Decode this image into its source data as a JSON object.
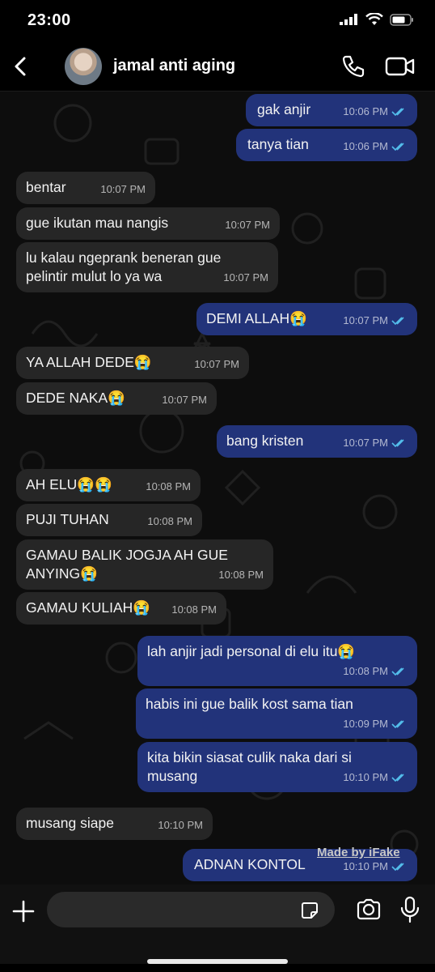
{
  "status_bar": {
    "time": "23:00"
  },
  "header": {
    "contact_name": "jamal anti aging"
  },
  "messages": [
    {
      "dir": "out",
      "text": "gak anjir",
      "time": "10:06 PM"
    },
    {
      "dir": "out",
      "text": "tanya tian",
      "time": "10:06 PM"
    },
    {
      "dir": "in",
      "text": "bentar",
      "time": "10:07 PM"
    },
    {
      "dir": "in",
      "text": "gue ikutan mau nangis",
      "time": "10:07 PM"
    },
    {
      "dir": "in",
      "text": "lu kalau ngeprank beneran gue\npelintir mulut lo ya wa",
      "time": "10:07 PM"
    },
    {
      "dir": "out",
      "text": "DEMI ALLAH😭",
      "time": "10:07 PM"
    },
    {
      "dir": "in",
      "text": "YA ALLAH DEDE😭",
      "time": "10:07 PM"
    },
    {
      "dir": "in",
      "text": "DEDE NAKA😭",
      "time": "10:07 PM"
    },
    {
      "dir": "out",
      "text": "bang kristen",
      "time": "10:07 PM"
    },
    {
      "dir": "in",
      "text": "AH ELU😭😭",
      "time": "10:08 PM"
    },
    {
      "dir": "in",
      "text": "PUJI TUHAN",
      "time": "10:08 PM"
    },
    {
      "dir": "in",
      "text": "GAMAU BALIK JOGJA AH GUE\nANYING😭",
      "time": "10:08 PM"
    },
    {
      "dir": "in",
      "text": "GAMAU KULIAH😭",
      "time": "10:08 PM"
    },
    {
      "dir": "out",
      "text": "lah anjir jadi personal di elu itu😭",
      "time": "10:08 PM"
    },
    {
      "dir": "out",
      "text": "habis ini gue balik kost sama tian",
      "time": "10:09 PM"
    },
    {
      "dir": "out",
      "text": "kita bikin siasat culik naka dari si\nmusang",
      "time": "10:10 PM"
    },
    {
      "dir": "in",
      "text": "musang siape",
      "time": "10:10 PM"
    },
    {
      "dir": "out",
      "text": "ADNAN KONTOL",
      "time": "10:10 PM"
    }
  ],
  "watermark": "Made by iFake",
  "icons": {
    "back": "chevron-left-icon",
    "call": "phone-icon",
    "video": "video-camera-icon",
    "attach": "plus-icon",
    "sticker": "sticker-icon",
    "camera": "camera-icon",
    "mic": "microphone-icon"
  },
  "colors": {
    "outgoing_bubble": "#22337a",
    "incoming_bubble": "#262626",
    "read_ticks": "#53bdeb"
  }
}
